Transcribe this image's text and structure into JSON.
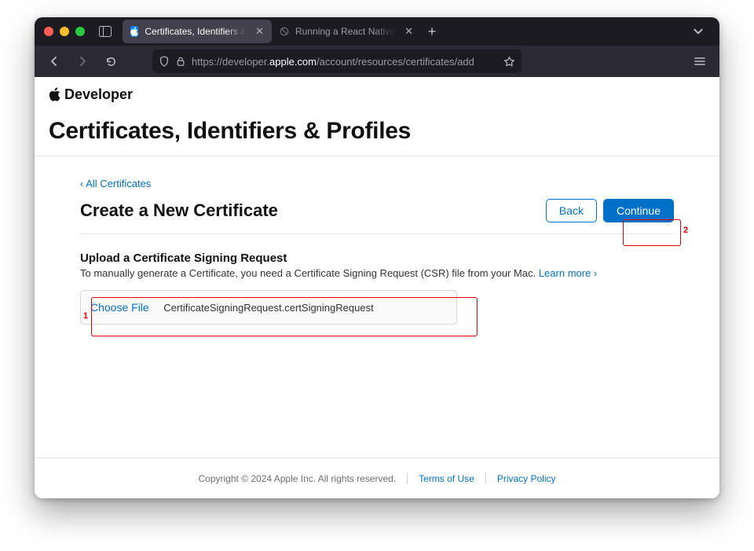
{
  "browser": {
    "tabs": [
      {
        "label": "Certificates, Identifiers & Profiles",
        "active": true
      },
      {
        "label": "Running a React Native App on",
        "active": false
      }
    ],
    "url": {
      "prefix": "https://developer.",
      "host": "apple.com",
      "path": "/account/resources/certificates/add"
    }
  },
  "page": {
    "brand": "Developer",
    "hero_title": "Certificates, Identifiers & Profiles",
    "back_link": "‹ All Certificates",
    "subtitle": "Create a New Certificate",
    "buttons": {
      "back": "Back",
      "continue": "Continue"
    },
    "section_heading": "Upload a Certificate Signing Request",
    "section_text": "To manually generate a Certificate, you need a Certificate Signing Request (CSR) file from your Mac. ",
    "learn_more": "Learn more ›",
    "choose_file_label": "Choose File",
    "selected_file": "CertificateSigningRequest.certSigningRequest"
  },
  "annotations": {
    "step1": "1",
    "step2": "2"
  },
  "footer": {
    "copyright": "Copyright © 2024 Apple Inc. All rights reserved.",
    "terms": "Terms of Use",
    "privacy": "Privacy Policy"
  }
}
